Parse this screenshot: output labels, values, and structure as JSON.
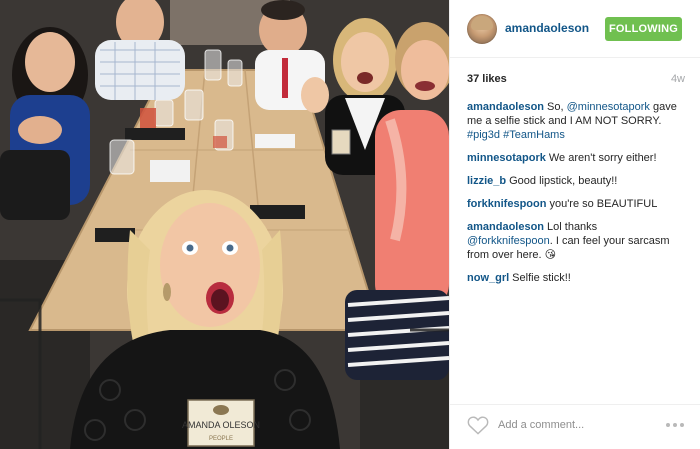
{
  "post": {
    "photo_alt": "selfie",
    "badge_text": "AMANDA OLESON",
    "badge_title": "PEOPLE"
  },
  "header": {
    "username": "amandaoleson",
    "follow_label": "FOLLOWING",
    "avatar_icon": "avatar-photo"
  },
  "meta": {
    "likes": "37 likes",
    "age": "4w"
  },
  "comments": [
    {
      "user": "amandaoleson",
      "parts": [
        {
          "t": "text",
          "v": "So, "
        },
        {
          "t": "link",
          "v": "@minnesotapork"
        },
        {
          "t": "text",
          "v": " gave me a selfie stick and I AM NOT SORRY. "
        },
        {
          "t": "tag",
          "v": "#pig3d"
        },
        {
          "t": "text",
          "v": " "
        },
        {
          "t": "tag",
          "v": "#TeamHams"
        }
      ]
    },
    {
      "user": "minnesotapork",
      "parts": [
        {
          "t": "text",
          "v": "We aren't sorry either!"
        }
      ]
    },
    {
      "user": "lizzie_b",
      "parts": [
        {
          "t": "text",
          "v": "Good lipstick, beauty!!"
        }
      ]
    },
    {
      "user": "forkknifespoon",
      "parts": [
        {
          "t": "text",
          "v": "you're so BEAUTIFUL"
        }
      ]
    },
    {
      "user": "amandaoleson",
      "parts": [
        {
          "t": "text",
          "v": "Lol thanks "
        },
        {
          "t": "link",
          "v": "@forkknifespoon"
        },
        {
          "t": "text",
          "v": ". I can feel your sarcasm from over here. 😘"
        }
      ]
    },
    {
      "user": "now_grl",
      "parts": [
        {
          "t": "text",
          "v": "Selfie stick!!"
        }
      ]
    }
  ],
  "footer": {
    "add_comment_placeholder": "Add a comment...",
    "like_icon": "heart-icon",
    "more_icon": "more-options-icon"
  },
  "colors": {
    "link": "#125688",
    "follow_button": "#70c050",
    "divider": "#efefef",
    "muted": "#a5a7aa"
  }
}
